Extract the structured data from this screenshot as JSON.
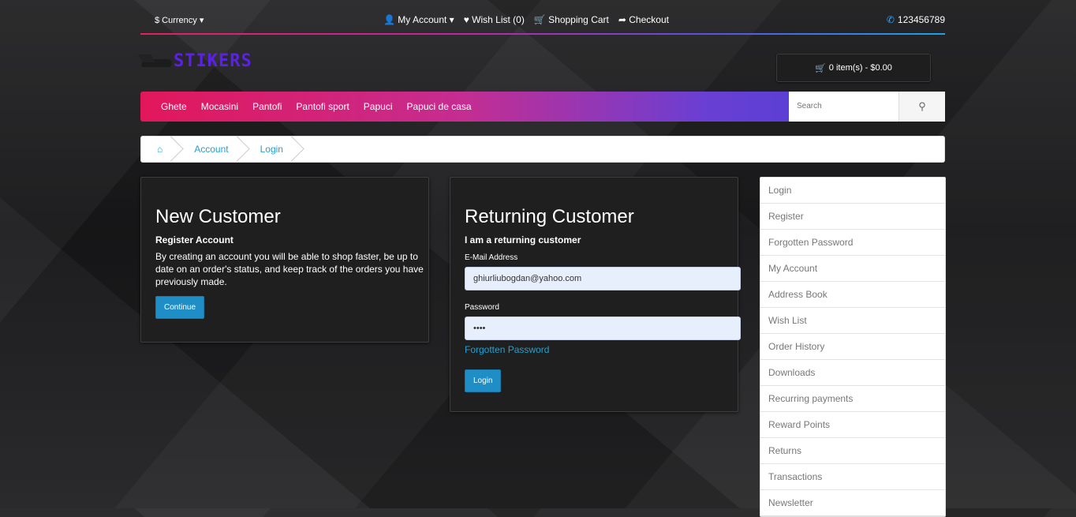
{
  "topbar": {
    "currency": "$ Currency ▾",
    "my_account": "My Account ▾",
    "wish_list": "Wish List (0)",
    "shopping_cart": "Shopping Cart",
    "checkout": "Checkout",
    "phone": "123456789"
  },
  "logo": {
    "text": "STIKERS"
  },
  "cart": {
    "label": "0 item(s) - $0.00"
  },
  "nav": {
    "items": [
      "Ghete",
      "Mocasini",
      "Pantofi",
      "Pantofi sport",
      "Papuci",
      "Papuci de casa"
    ],
    "search_placeholder": "Search"
  },
  "breadcrumb": {
    "items": [
      "Account",
      "Login"
    ]
  },
  "new_customer": {
    "title": "New Customer",
    "subtitle": "Register Account",
    "text": "By creating an account you will be able to shop faster, be up to date on an order's status, and keep track of the orders you have previously made.",
    "button": "Continue"
  },
  "returning_customer": {
    "title": "Returning Customer",
    "subtitle": "I am a returning customer",
    "email_label": "E-Mail Address",
    "email_value": "ghiurliubogdan@yahoo.com",
    "password_label": "Password",
    "password_value": "••••",
    "forgotten": "Forgotten Password",
    "button": "Login"
  },
  "account_list": [
    "Login",
    "Register",
    "Forgotten Password",
    "My Account",
    "Address Book",
    "Wish List",
    "Order History",
    "Downloads",
    "Recurring payments",
    "Reward Points",
    "Returns",
    "Transactions",
    "Newsletter"
  ],
  "colors": {
    "accent_blue": "#1f8ec6",
    "nav_start": "#e2175b",
    "nav_end": "#5a3fd4",
    "logo": "#5b21e6"
  }
}
